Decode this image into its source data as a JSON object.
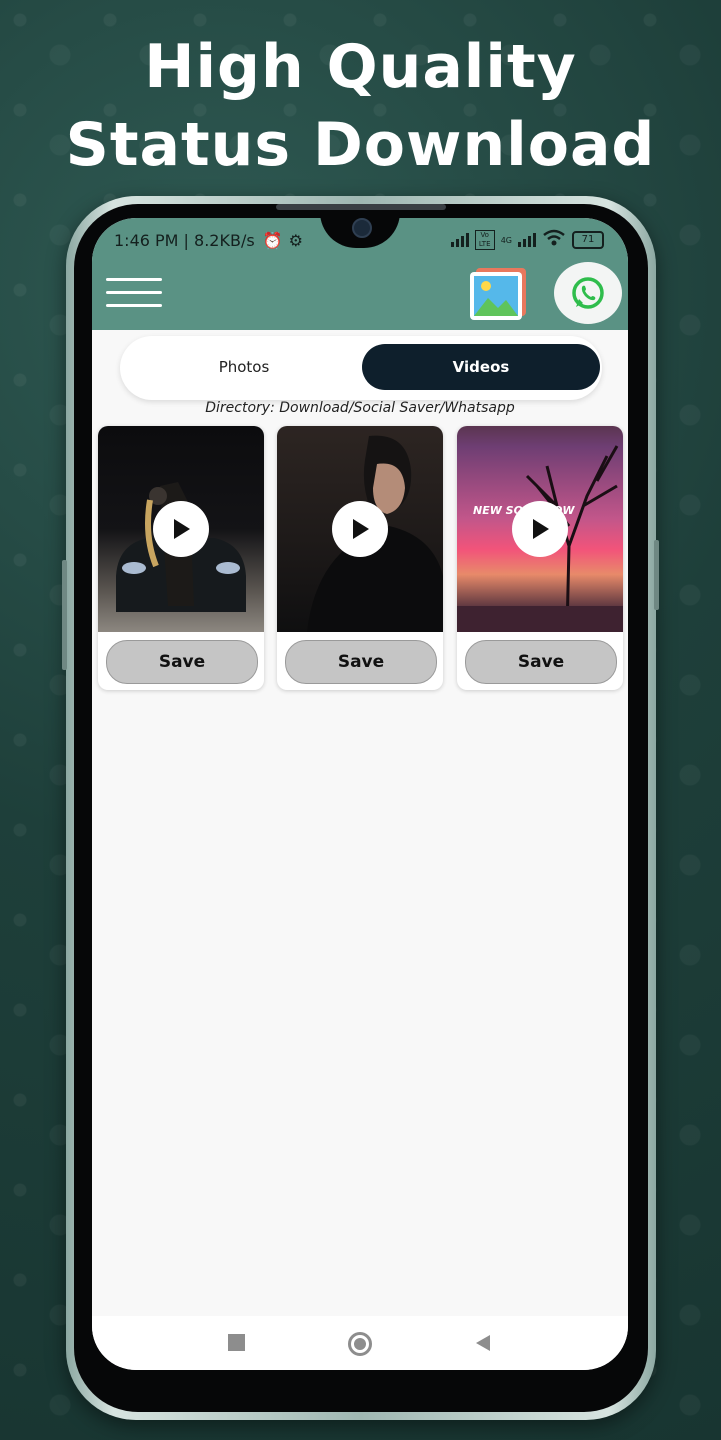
{
  "promo": {
    "line1": "High Quality",
    "line2": "Status Download"
  },
  "status_bar": {
    "time_speed": "1:46 PM | 8.2KB/s",
    "battery": "71",
    "network_badge": "Vo LTE",
    "network_gen": "4G"
  },
  "toolbar": {
    "menu_icon": "hamburger-icon",
    "gallery_icon": "gallery-icon",
    "whatsapp_icon": "whatsapp-icon"
  },
  "tabs": [
    {
      "label": "Photos",
      "selected": false
    },
    {
      "label": "Videos",
      "selected": true
    }
  ],
  "directory": "Directory: Download/Social Saver/Whatsapp",
  "videos": [
    {
      "save_label": "Save",
      "overlay_text": ""
    },
    {
      "save_label": "Save",
      "overlay_text": ""
    },
    {
      "save_label": "Save",
      "overlay_text": "NEW SO     ORROW"
    }
  ],
  "nav": {
    "recents_icon": "square-icon",
    "home_icon": "circle-icon",
    "back_icon": "triangle-back-icon"
  },
  "colors": {
    "appbar": "#5a9284",
    "selected_tab": "#0e1f2c",
    "save_button": "#c5c5c5",
    "background": "#1e3f3a"
  }
}
